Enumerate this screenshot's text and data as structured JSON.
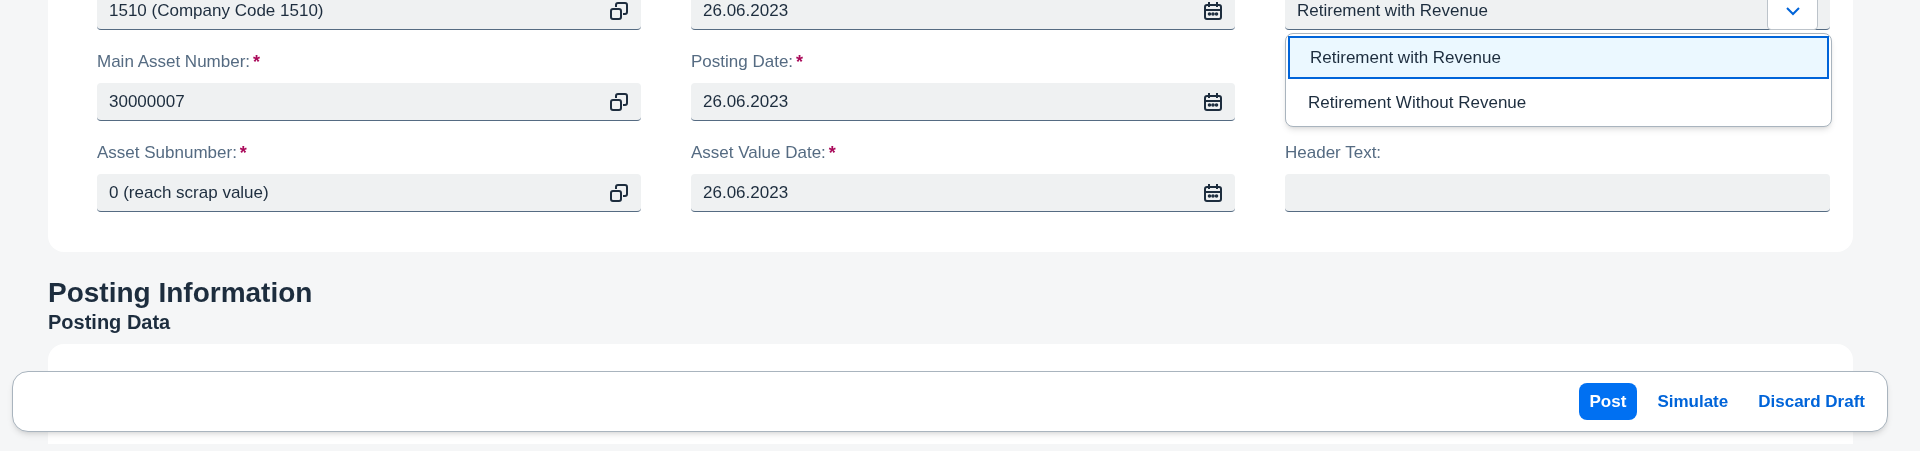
{
  "form_columns": [
    {
      "fields": [
        {
          "kind": "value_help",
          "value": "1510 (Company Code 1510)"
        },
        {
          "kind": "value_help",
          "label": "Main Asset Number:",
          "required_mark": "*",
          "value": "30000007"
        },
        {
          "kind": "value_help",
          "label": "Asset Subnumber:",
          "required_mark": "*",
          "value": "0 (reach scrap value)"
        }
      ]
    },
    {
      "fields": [
        {
          "kind": "date",
          "value": "26.06.2023"
        },
        {
          "kind": "date",
          "label": "Posting Date:",
          "required_mark": "*",
          "value": "26.06.2023"
        },
        {
          "kind": "date",
          "label": "Asset Value Date:",
          "required_mark": "*",
          "value": "26.06.2023"
        }
      ]
    },
    {
      "fields": [
        {
          "kind": "combo",
          "value": "Retirement with Revenue",
          "expanded": true,
          "options": [
            {
              "label": "Retirement with Revenue",
              "selected": true
            },
            {
              "label": "Retirement Without Revenue",
              "selected": false
            }
          ]
        },
        {
          "kind": "text",
          "label": "Header Text:"
        }
      ]
    }
  ],
  "section_title": "Posting Information",
  "subsection_title": "Posting Data",
  "footer_actions": [
    {
      "label": "Post",
      "kind": "emphasized"
    },
    {
      "label": "Simulate",
      "kind": "transparent"
    },
    {
      "label": "Discard Draft",
      "kind": "transparent"
    }
  ]
}
